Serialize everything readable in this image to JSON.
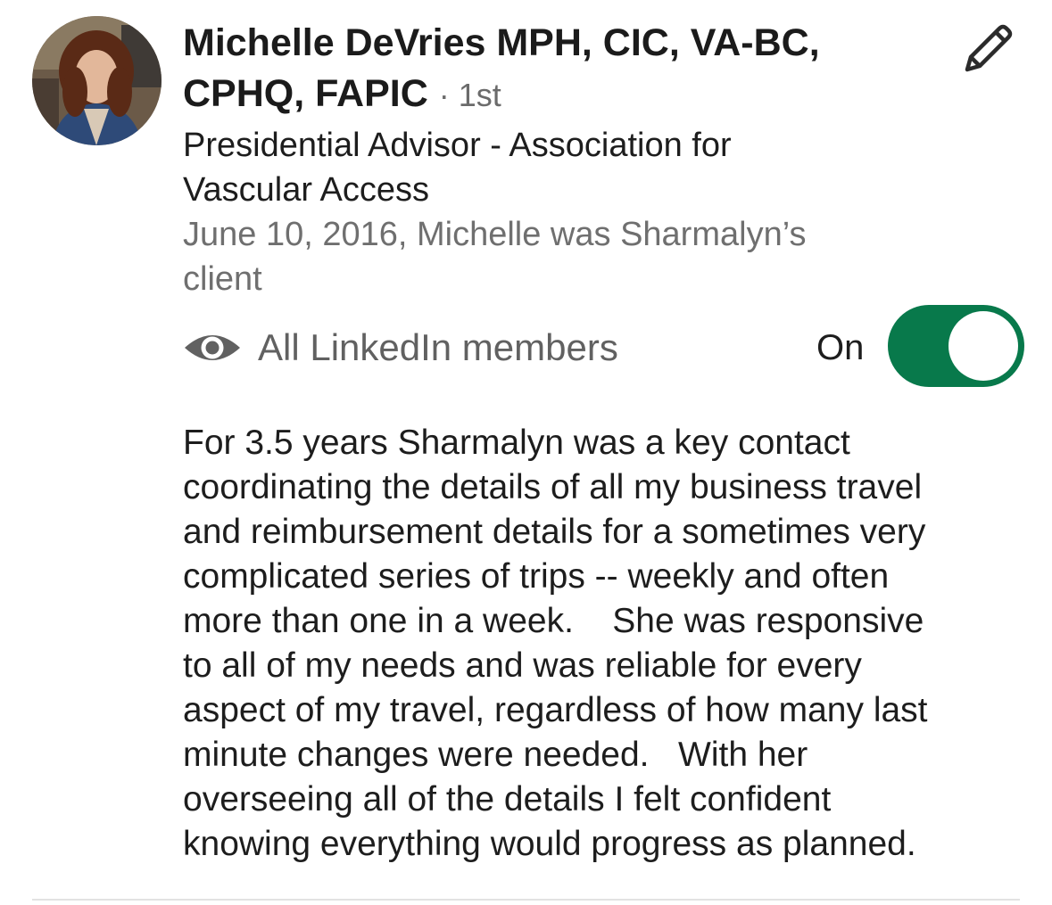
{
  "recommender": {
    "name": "Michelle DeVries MPH, CIC, VA-BC, CPHQ, FAPIC",
    "connection_degree": "· 1st",
    "headline": "Presidential Advisor - Association for Vascular Access",
    "relationship": "June 10, 2016, Michelle was Sharmalyn’s client"
  },
  "visibility": {
    "label": "All LinkedIn members",
    "toggle_label": "On",
    "enabled": true,
    "accent_color": "#08794b"
  },
  "recommendation": {
    "text_lines": [
      "For 3.5 years Sharmalyn was a key contact",
      "coordinating the details of all my business travel",
      "and reimbursement details for a sometimes very",
      "complicated series of trips -- weekly and often",
      "more than one in a week.    She was responsive",
      "to all of my needs and was reliable for every",
      "aspect of my travel, regardless of how many last",
      "minute changes were needed.   With her",
      "overseeing all of the details I felt confident",
      "knowing everything would progress as planned."
    ]
  },
  "icons": {
    "edit": "pencil-icon",
    "visibility": "eye-icon"
  }
}
